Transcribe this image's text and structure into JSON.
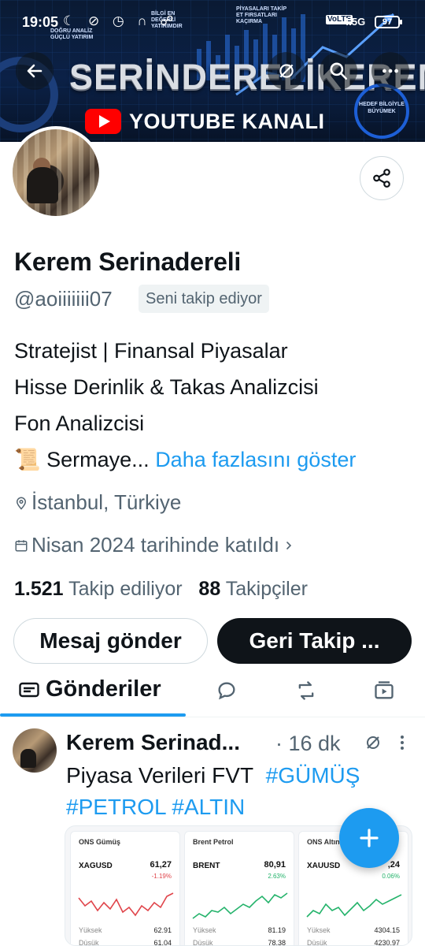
{
  "status_bar": {
    "time": "19:05",
    "network": "4.5G",
    "network_sub": "VoLTE",
    "battery": "97"
  },
  "banner": {
    "brand": "SERİNDERELİKEREM",
    "youtube": "YOUTUBE KANALI",
    "top_left_caption": "DOĞRU ANALİZ GÜÇLÜ YATIRIM",
    "top_mid_caption": "BİLGİ EN DEĞERLİ YATIRIMDIR",
    "top_right_caption": "PİYASALARI TAKİP ET FIRSATLARI KAÇIRMA",
    "goal_caption": "HEDEF BİLGİYLE BÜYÜMEK"
  },
  "profile": {
    "name": "Kerem Serinadereli",
    "handle": "@aoiiiiiii07",
    "follows_you": "Seni takip ediyor",
    "bio_lines": [
      "Stratejist | Finansal Piyasalar",
      "Hisse Derinlik & Takas Analizcisi",
      "Fon Analizcisi"
    ],
    "bio_last": "📜 Sermaye...",
    "show_more": "Daha fazlasını göster",
    "location": "İstanbul, Türkiye",
    "joined": "Nisan 2024 tarihinde katıldı",
    "following_count": "1.521",
    "following_label": "Takip ediliyor",
    "followers_count": "88",
    "followers_label": "Takipçiler"
  },
  "actions": {
    "message": "Mesaj gönder",
    "follow_back": "Geri Takip ..."
  },
  "tabs": {
    "posts": "Gönderiler"
  },
  "post": {
    "author": "Kerem Serinad...",
    "time": "· 16 dk",
    "text": "Piyasa Verileri FVT",
    "tags": [
      "#GÜMÜŞ",
      "#PETROL",
      "#ALTIN"
    ]
  },
  "cards": [
    {
      "title": "ONS Gümüş",
      "symbol": "XAGUSD",
      "price": "61,27",
      "change": "-1.19%",
      "high_label": "Yüksek",
      "high": "62.91",
      "low_label": "Düşük",
      "low": "61.04",
      "color": "#e0454b"
    },
    {
      "title": "Brent Petrol",
      "symbol": "BRENT",
      "price": "80,91",
      "change": "2.63%",
      "high_label": "Yüksek",
      "high": "81.19",
      "low_label": "Düşük",
      "low": "78.38",
      "color": "#24b36b"
    },
    {
      "title": "ONS Altın",
      "symbol": "XAUUSD",
      "price": ",24",
      "change": "0.06%",
      "high_label": "Yüksek",
      "high": "4304.15",
      "low_label": "Düşük",
      "low": "4230.97",
      "color": "#24b36b"
    }
  ]
}
